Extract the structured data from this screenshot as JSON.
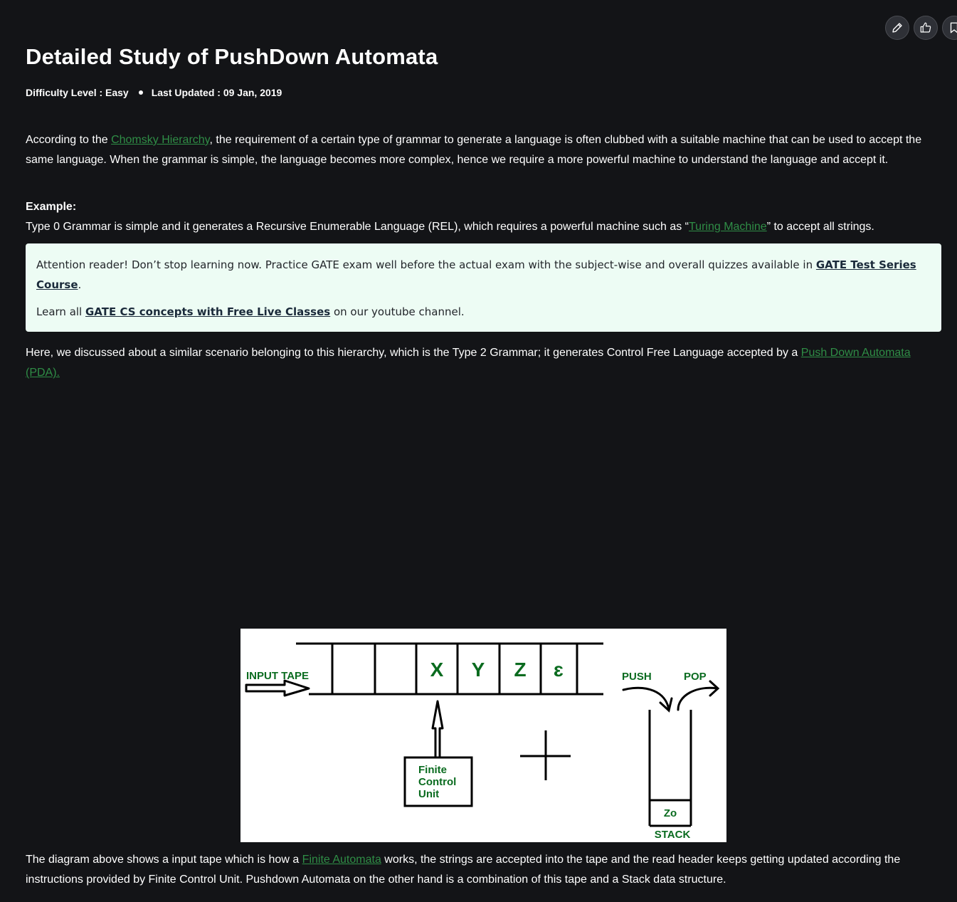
{
  "toolbar": {
    "buttons": [
      {
        "icon": "pencil-icon",
        "label": "edit"
      },
      {
        "icon": "thumbs-up-icon",
        "label": "like"
      },
      {
        "icon": "bookmark-icon",
        "label": "bookmark"
      }
    ]
  },
  "article": {
    "title": "Detailed Study of PushDown Automata",
    "difficulty": "Difficulty Level : Easy",
    "updated": "Last Updated : 09 Jan, 2019"
  },
  "para1": {
    "prefix": "According to the ",
    "link": "Chomsky Hierarchy",
    "suffix": ", the requirement of a certain type of grammar to generate a language is often clubbed with a suitable machine that can be used to accept the same language. When the grammar is simple, the language becomes more complex, hence we require a more powerful machine to understand the language and accept it."
  },
  "example": {
    "label": "Example:",
    "prefix": "Type 0 Grammar is simple and it generates a Recursive Enumerable Language (REL), which requires a powerful machine such as “",
    "link": "Turing Machine",
    "suffix": "” to accept all strings."
  },
  "callout": {
    "line1_prefix": "Attention reader! Don’t stop learning now.  Practice GATE exam well before the actual exam with the subject-wise and overall quizzes available in ",
    "line1_link": "GATE Test Series Course",
    "line1_suffix": ".",
    "line2_prefix": "Learn all ",
    "line2_link": "GATE CS concepts with Free Live Classes",
    "line2_suffix": " on our youtube channel."
  },
  "para2": {
    "prefix": "Here, we discussed about a similar scenario belonging to this hierarchy, which is the Type 2 Grammar; it generates Control Free Language accepted by a ",
    "link": "Push Down Automata (PDA)."
  },
  "diagram": {
    "input_tape_label": "INPUT TAPE",
    "cells": [
      "",
      "",
      "X",
      "Y",
      "Z",
      "ɛ"
    ],
    "fcu_line1": "Finite",
    "fcu_line2": "Control",
    "fcu_line3": "Unit",
    "push_label": "PUSH",
    "pop_label": "POP",
    "stack_item": "Zo",
    "stack_label": "STACK",
    "colors": {
      "green": "#0a6b1f",
      "black": "#000000"
    }
  },
  "para3": {
    "prefix": "The diagram above shows a input tape which is how a ",
    "link": "Finite Automata",
    "suffix": " works, the strings are accepted into the tape and the read header keeps getting updated according the instructions provided by Finite Control Unit. Pushdown Automata on the other hand is a combination of this tape and a Stack data structure."
  }
}
